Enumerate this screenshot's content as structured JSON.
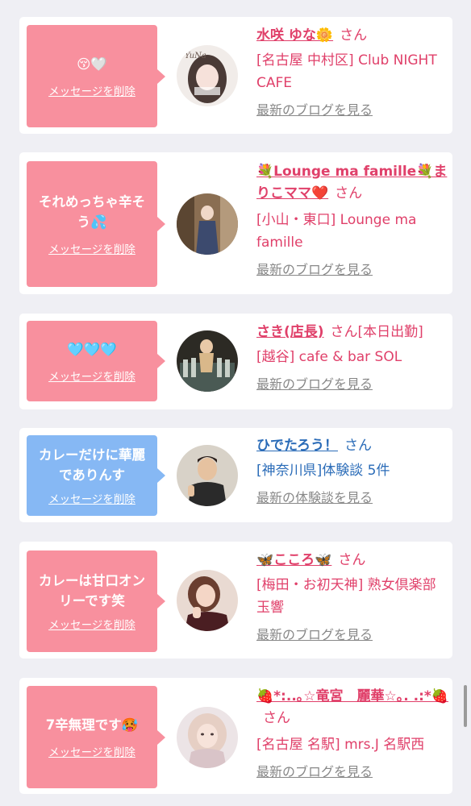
{
  "colors": {
    "pink": "#f8909e",
    "blue": "#86b8f4",
    "name_pink": "#e0406a",
    "name_blue": "#2b6cb8"
  },
  "messages": [
    {
      "bubble_text": "😚🤍",
      "delete_label": "メッセージを削除",
      "name": "水咲 ゆな🌼",
      "honorific": "さん",
      "extra": "",
      "location": "[名古屋 中村区] Club NIGHT CAFE",
      "link": "最新のブログを見る",
      "avatar_overlay": "YuNa"
    },
    {
      "bubble_text": "それめっちゃ辛そう💦",
      "delete_label": "メッセージを削除",
      "name": "💐Lounge ma famille💐まりこママ❤️",
      "honorific": "さん",
      "extra": "",
      "location": "[小山・東口] Lounge ma famille",
      "link": "最新のブログを見る",
      "avatar_overlay": ""
    },
    {
      "bubble_text": "🩵🩵🩵",
      "delete_label": "メッセージを削除",
      "name": "さき(店長)",
      "honorific": "さん",
      "extra": "[本日出勤]",
      "location": "[越谷] cafe & bar SOL",
      "link": "最新のブログを見る",
      "avatar_overlay": ""
    },
    {
      "bubble_text": "カレーだけに華麗でありんす",
      "delete_label": "メッセージを削除",
      "name": "ひでたろう！",
      "honorific": "さん",
      "extra": "",
      "location": "[神奈川県]体験談 5件",
      "link": "最新の体験談を見る",
      "avatar_overlay": ""
    },
    {
      "bubble_text": "カレーは甘口オンリーです笑",
      "delete_label": "メッセージを削除",
      "name": "🦋こころ🦋",
      "honorific": "さん",
      "extra": "",
      "location": "[梅田・お初天神] 熟女倶楽部 玉響",
      "link": "最新のブログを見る",
      "avatar_overlay": ""
    },
    {
      "bubble_text": "7辛無理です🥵",
      "delete_label": "メッセージを削除",
      "name": "🍓*:..｡☆竜宮　麗華☆｡. .:*🍓",
      "honorific": "さん",
      "extra": "",
      "location": "[名古屋 名駅] mrs.J 名駅西",
      "link": "最新のブログを見る",
      "avatar_overlay": ""
    }
  ]
}
